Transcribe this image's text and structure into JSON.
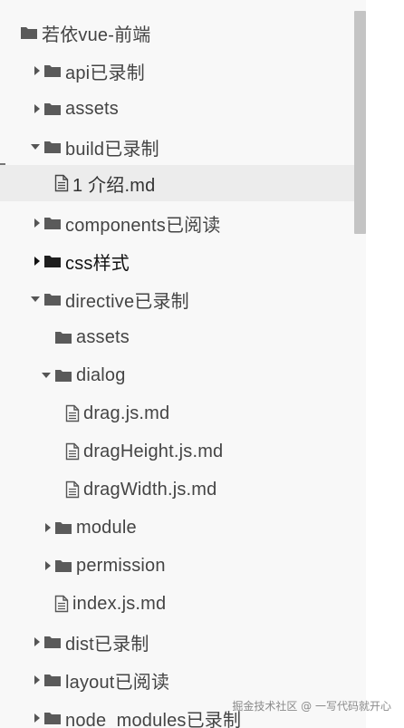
{
  "tree": {
    "items": [
      {
        "label": "若依vue-前端",
        "type": "folder",
        "expander": "none"
      },
      {
        "label": "api已录制",
        "type": "folder",
        "expander": "collapsed"
      },
      {
        "label": "assets",
        "type": "folder",
        "expander": "collapsed"
      },
      {
        "label": "build已录制",
        "type": "folder",
        "expander": "expanded"
      },
      {
        "label": "1 介绍.md",
        "type": "file",
        "expander": "none",
        "selected": true
      },
      {
        "label": "components已阅读",
        "type": "folder",
        "expander": "collapsed"
      },
      {
        "label": "css样式",
        "type": "folder",
        "expander": "collapsed",
        "dark": true
      },
      {
        "label": "directive已录制",
        "type": "folder",
        "expander": "expanded"
      },
      {
        "label": "assets",
        "type": "folder",
        "expander": "none"
      },
      {
        "label": "dialog",
        "type": "folder",
        "expander": "expanded"
      },
      {
        "label": "drag.js.md",
        "type": "file",
        "expander": "none"
      },
      {
        "label": "dragHeight.js.md",
        "type": "file",
        "expander": "none"
      },
      {
        "label": "dragWidth.js.md",
        "type": "file",
        "expander": "none"
      },
      {
        "label": "module",
        "type": "folder",
        "expander": "collapsed"
      },
      {
        "label": "permission",
        "type": "folder",
        "expander": "collapsed"
      },
      {
        "label": "index.js.md",
        "type": "file",
        "expander": "none"
      },
      {
        "label": "dist已录制",
        "type": "folder",
        "expander": "collapsed"
      },
      {
        "label": "layout已阅读",
        "type": "folder",
        "expander": "collapsed"
      },
      {
        "label": "node_modules已录制",
        "type": "folder",
        "expander": "collapsed"
      }
    ]
  },
  "watermark": "掘金技术社区 @ 一写代码就开心",
  "colors": {
    "folder": "#5a5a5a",
    "folder_dark": "#1e1e1e",
    "text": "#444444",
    "selected_bg": "#ececec",
    "scroll_thumb": "#c4c4c4"
  }
}
